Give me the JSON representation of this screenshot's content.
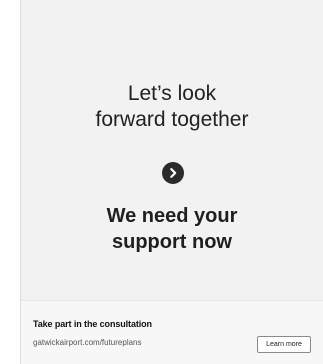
{
  "ad": {
    "headline_line1": "Let’s look",
    "headline_line2": "forward together",
    "cta_line1": "We need your",
    "cta_line2": "support now",
    "arrow_icon": "chevron-right-icon"
  },
  "footer": {
    "title": "Take part in the consultation",
    "url": "gatwickairport.com/futureplans",
    "button_label": "Learn more"
  },
  "colors": {
    "background": "#f2f2f2",
    "text": "#222222",
    "button_circle": "#2b2b2b"
  }
}
